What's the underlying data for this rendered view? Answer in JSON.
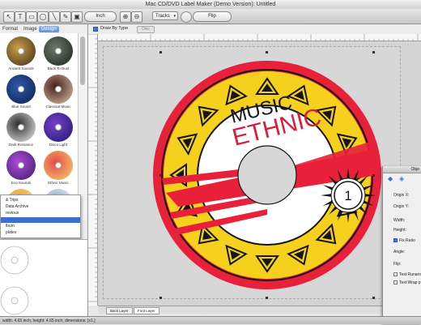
{
  "window": {
    "title": "Mac CD/DVD Label Maker (Demo Version): Untitled"
  },
  "toolbar": {
    "tools": [
      {
        "name": "text-tool",
        "glyph": "T"
      },
      {
        "name": "rect-tool",
        "glyph": "▭"
      },
      {
        "name": "ellipse-tool",
        "glyph": "◯"
      },
      {
        "name": "line-tool",
        "glyph": "╲"
      },
      {
        "name": "pen-tool",
        "glyph": "✎"
      }
    ],
    "units": "Inch",
    "zoom_in_glyph": "⊕",
    "zoom_out_glyph": "⊖",
    "tracks_select": "Tracks",
    "flip_label": "Flip"
  },
  "sidebar": {
    "tabs": [
      {
        "label": "Format",
        "active": false
      },
      {
        "label": "Image",
        "active": false
      },
      {
        "label": "Design",
        "active": true
      }
    ],
    "thumbnails": [
      {
        "caption": "Ancient Sounds",
        "color1": "#caa046",
        "color2": "#3a2a18"
      },
      {
        "caption": "Back To Dust",
        "color1": "#6b7a68",
        "color2": "#1c211b"
      },
      {
        "caption": "Blue Sound",
        "color1": "#2d5aa8",
        "color2": "#0a1f4c"
      },
      {
        "caption": "Classical Music",
        "color1": "#4a1c1c",
        "color2": "#d8c8a8"
      },
      {
        "caption": "Dark Romance",
        "color1": "#2c2c2c",
        "color2": "#f1f1f1"
      },
      {
        "caption": "Disco Light",
        "color1": "#7a3fd1",
        "color2": "#1a1a66"
      },
      {
        "caption": "Eco Sounds",
        "color1": "#b04ad9",
        "color2": "#3a1b69"
      },
      {
        "caption": "Ethnic Music",
        "color1": "#e64a4a",
        "color2": "#f4d56a"
      },
      {
        "caption": "",
        "color1": "#e89a3a",
        "color2": "#f7e08a"
      },
      {
        "caption": "",
        "color1": "#8aa6c9",
        "color2": "#ffffff"
      }
    ],
    "menu_items": [
      {
        "label": "& Trips",
        "selected": false
      },
      {
        "label": "Data Archive",
        "selected": false
      },
      {
        "label": "revious",
        "selected": false
      },
      {
        "label": "",
        "selected": true
      },
      {
        "label": "lbum",
        "selected": false
      },
      {
        "label": "plates",
        "selected": false
      }
    ]
  },
  "options": {
    "draw_by_type_label": "Draw By Type",
    "draw_by_type_checked": true,
    "disc_button": "Disc"
  },
  "label": {
    "title_line1": "MUSIC",
    "title_line2": "ETHNIC",
    "track_number": "1",
    "colors": {
      "outer_ring": "#e8203a",
      "yellow_band": "#f5d11d",
      "inner_white": "#ffffff",
      "ink": "#151515",
      "red_text": "#d81e3c"
    }
  },
  "layers": [
    {
      "label": "Back Layer",
      "active": false
    },
    {
      "label": "Font Layer",
      "active": true
    }
  ],
  "inspector": {
    "header": "Obje",
    "origin_x": "Origin X:",
    "origin_y": "Origin Y:",
    "width": "Width:",
    "height": "Height:",
    "fix_ratio": "Fix Ratio",
    "fix_ratio_checked": true,
    "angle": "Angle:",
    "flip": "Flip:",
    "text_runaround": "Text Runaro",
    "text_wrap": "Text Wrap p"
  },
  "status": {
    "text": "width: 4.65 inch; height: 4.65 inch; dimensions: [x1.]"
  }
}
